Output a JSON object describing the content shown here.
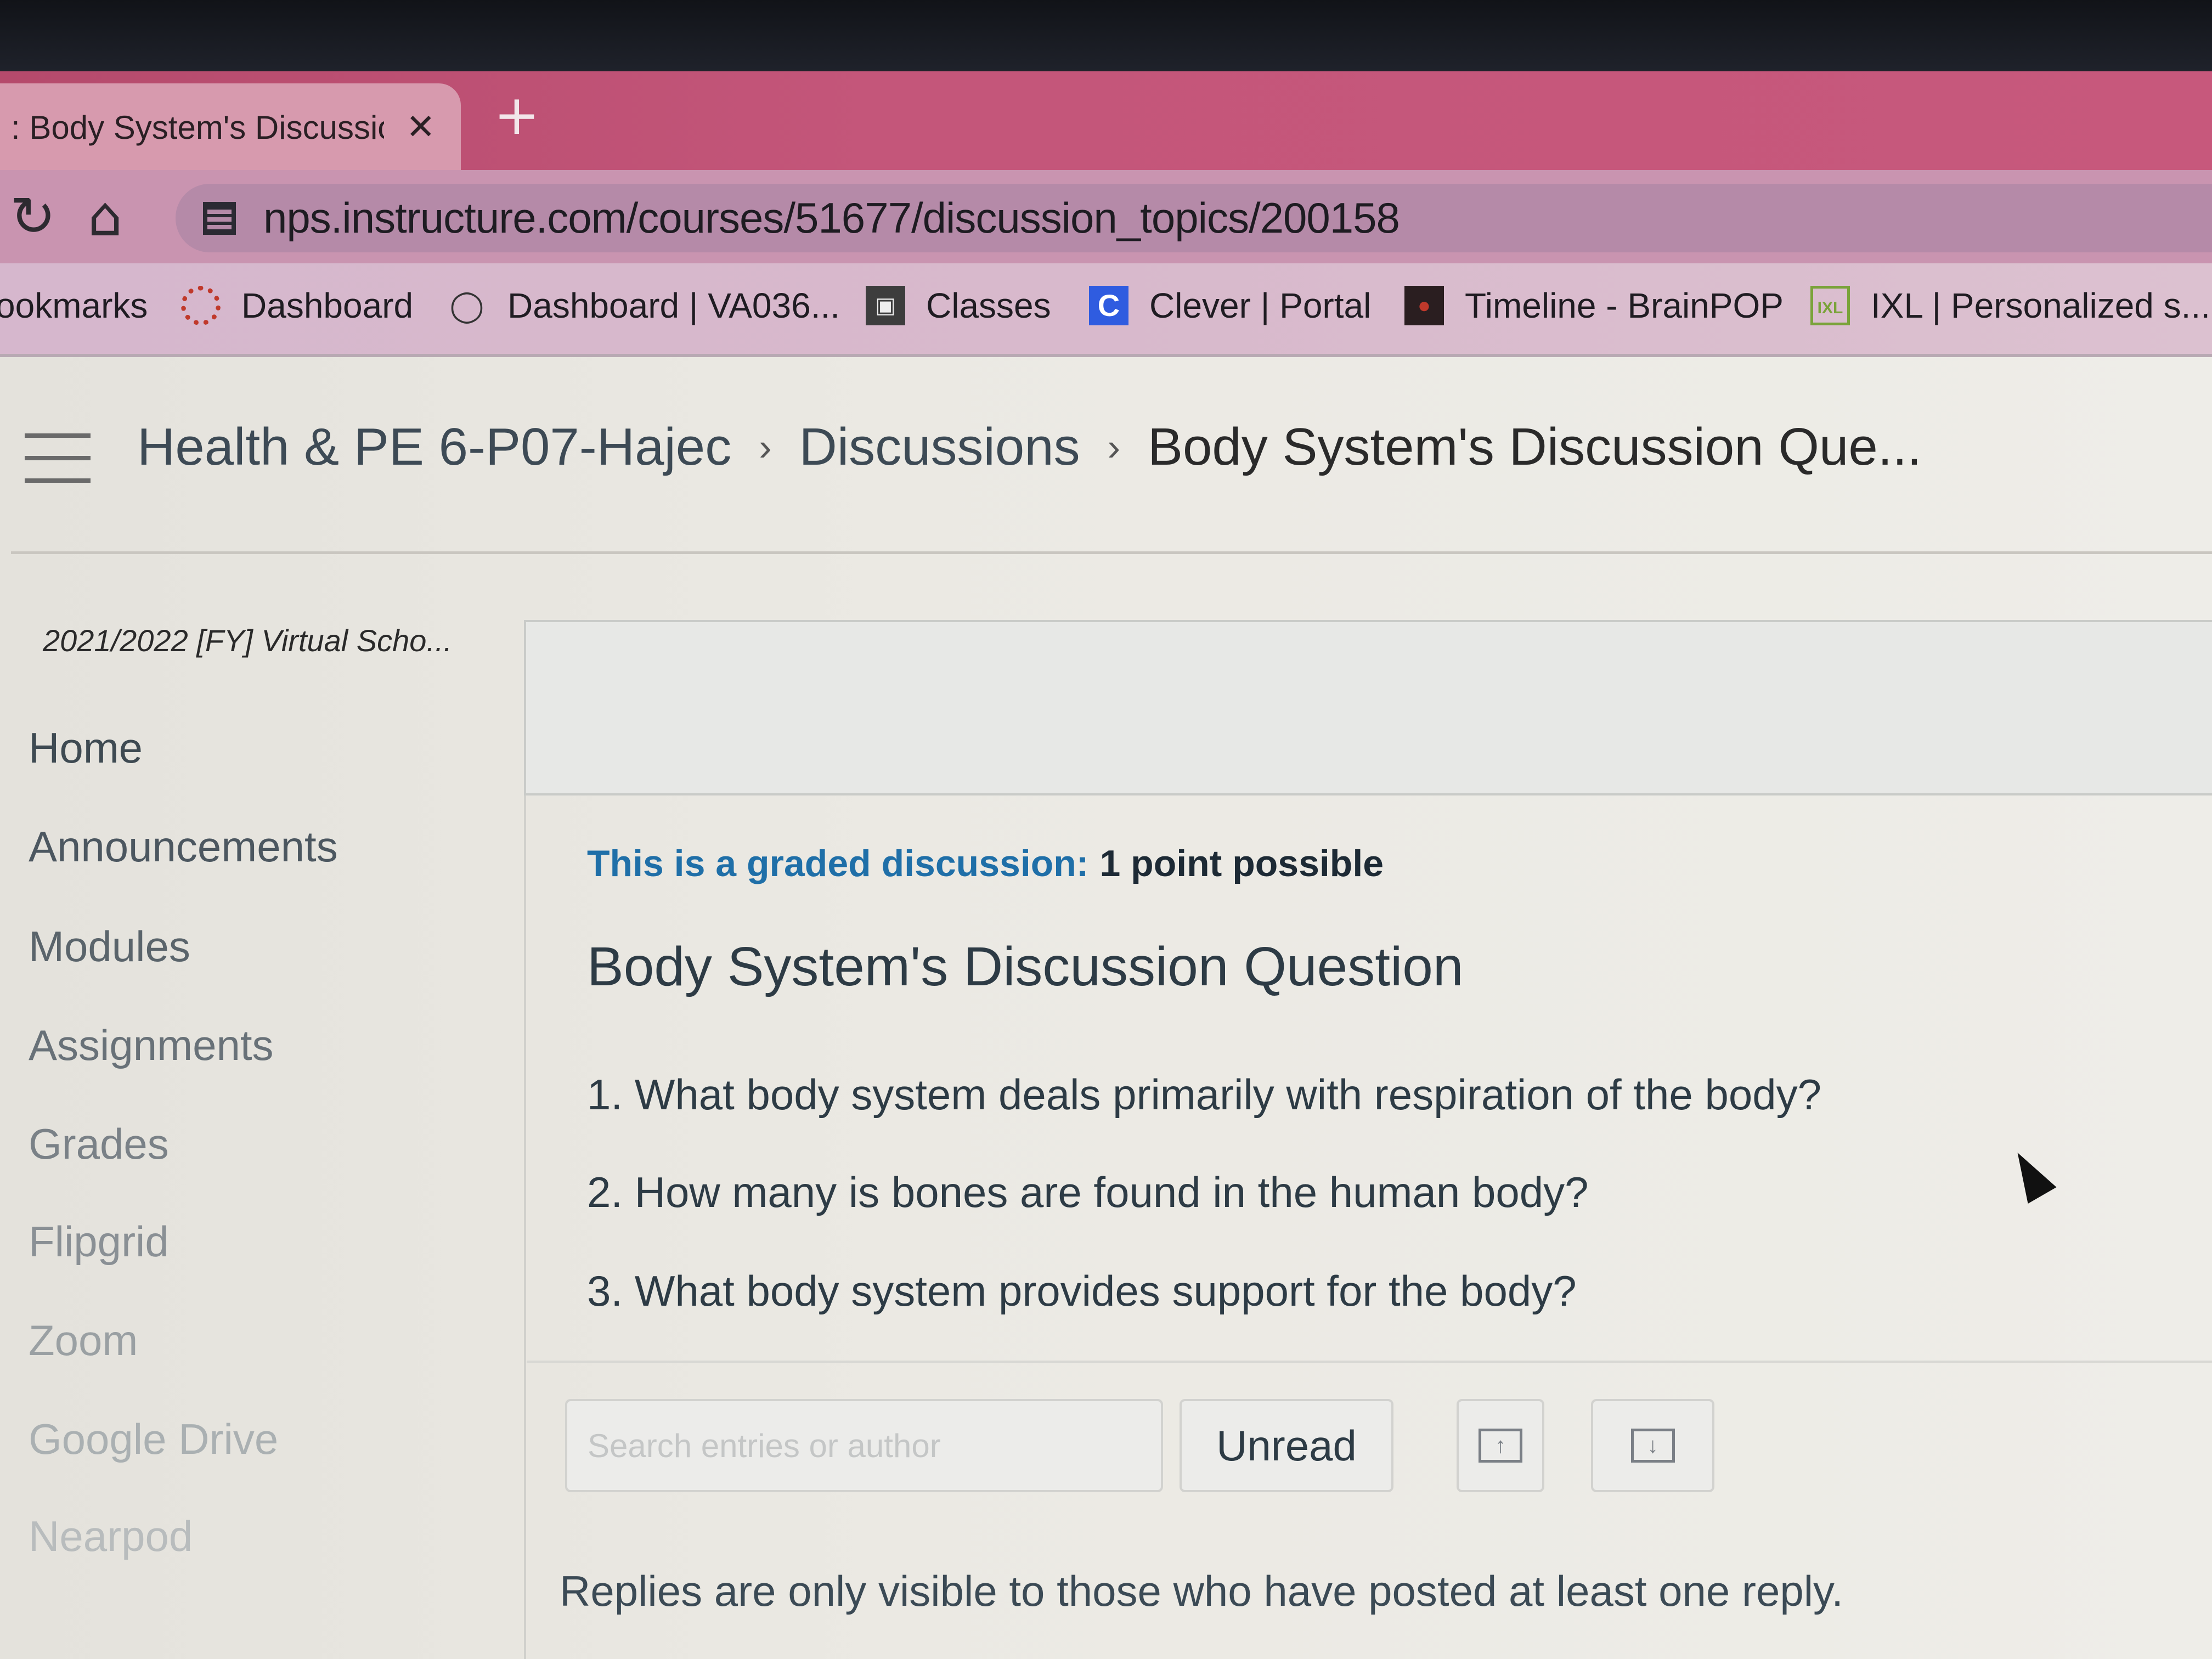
{
  "browser": {
    "tab_title": ": Body System's Discussion",
    "tab_close": "✕",
    "new_tab": "+",
    "url": "nps.instructure.com/courses/51677/discussion_topics/200158",
    "bookmarks_label": "ookmarks",
    "bookmarks": [
      {
        "label": "Dashboard",
        "icon": "canvas-icon"
      },
      {
        "label": "Dashboard | VA036...",
        "icon": "lightbulb-icon"
      },
      {
        "label": "Classes",
        "icon": "classes-icon"
      },
      {
        "label": "Clever | Portal",
        "icon": "clever-icon"
      },
      {
        "label": "Timeline - BrainPOP",
        "icon": "brainpop-icon"
      },
      {
        "label": "IXL | Personalized s...",
        "icon": "ixl-icon"
      }
    ]
  },
  "breadcrumb": {
    "course": "Health & PE 6-P07-Hajec",
    "section": "Discussions",
    "current": "Body System's Discussion Que..."
  },
  "sidebar": {
    "term": "2021/2022 [FY] Virtual Scho...",
    "items": [
      {
        "label": "Home"
      },
      {
        "label": "Announcements"
      },
      {
        "label": "Modules"
      },
      {
        "label": "Assignments"
      },
      {
        "label": "Grades"
      },
      {
        "label": "Flipgrid"
      },
      {
        "label": "Zoom"
      },
      {
        "label": "Google Drive"
      },
      {
        "label": "Nearpod"
      }
    ]
  },
  "discussion": {
    "graded_label": "This is a graded discussion:",
    "points": "1 point possible",
    "title": "Body System's Discussion Question",
    "questions": [
      "1. What body system deals primarily with respiration of the body?",
      "2. How many is bones are found in the human body?",
      "3. What body system provides support for the body?"
    ],
    "search_placeholder": "Search entries or author",
    "unread_label": "Unread",
    "replies_note": "Replies are only visible to those who have posted at least one reply."
  },
  "colors": {
    "tab_strip": "#c4567a",
    "graded_blue": "#1f6fa8",
    "text_dark": "#2d3b45"
  }
}
